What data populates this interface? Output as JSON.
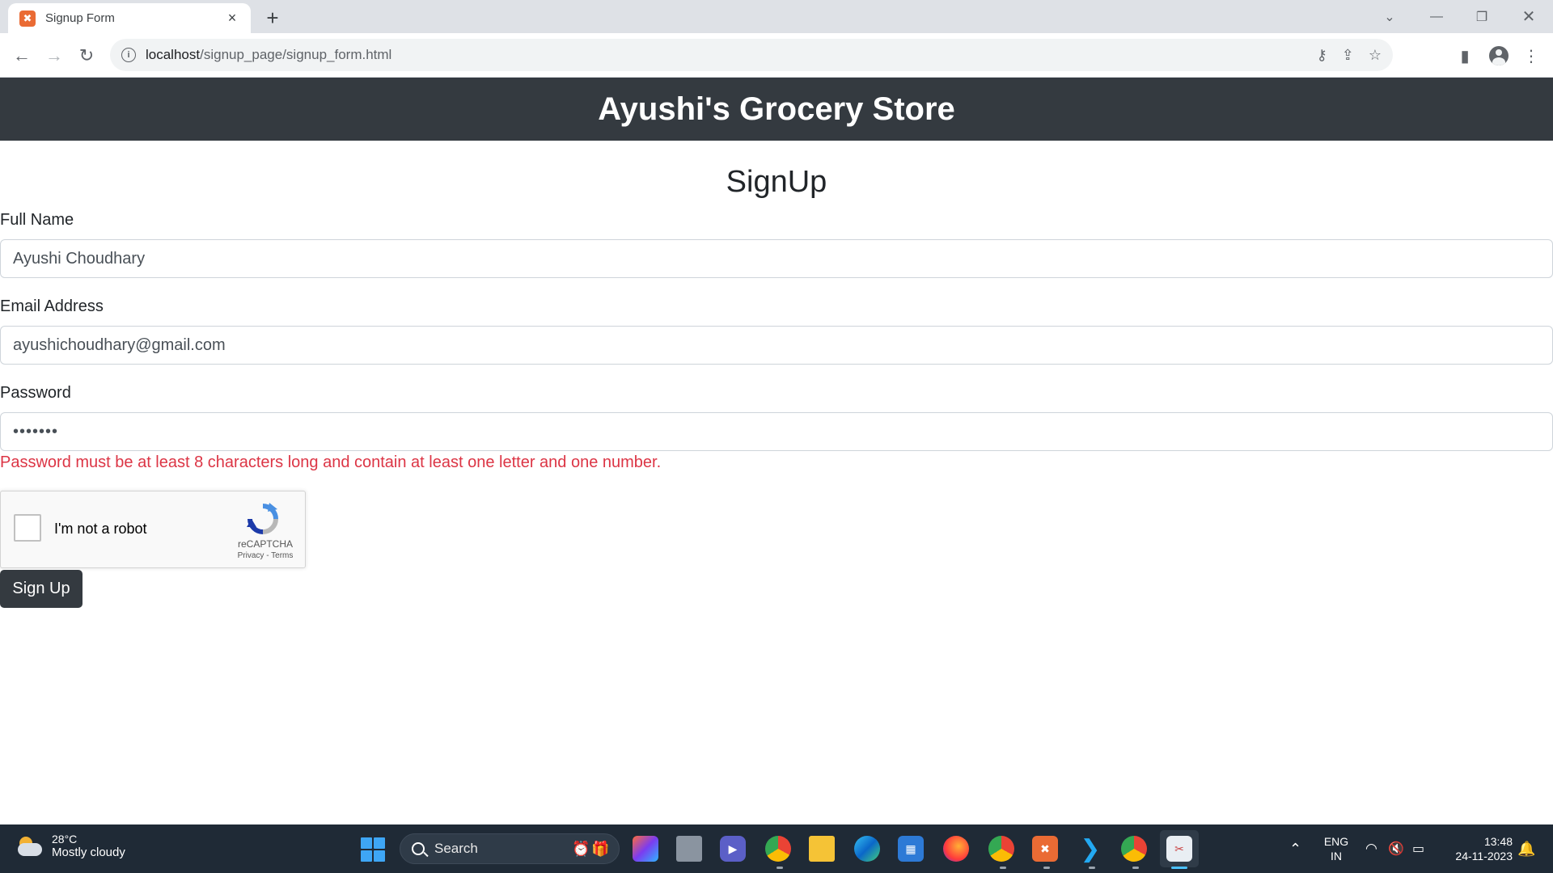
{
  "browser": {
    "tab_title": "Signup Form",
    "url_host": "localhost",
    "url_path": "/signup_page/signup_form.html",
    "favicon_letter": "✖"
  },
  "page": {
    "site_title": "Ayushi's Grocery Store",
    "form_title": "SignUp",
    "fields": {
      "full_name": {
        "label": "Full Name",
        "value": "Ayushi Choudhary"
      },
      "email": {
        "label": "Email Address",
        "value": "ayushichoudhary@gmail.com"
      },
      "password": {
        "label": "Password",
        "value": "•••••••"
      }
    },
    "password_error": "Password must be at least 8 characters long and contain at least one letter and one number.",
    "captcha": {
      "label": "I'm not a robot",
      "brand": "reCAPTCHA",
      "terms": "Privacy - Terms"
    },
    "submit_label": "Sign Up"
  },
  "taskbar": {
    "weather_temp": "28°C",
    "weather_desc": "Mostly cloudy",
    "search_label": "Search",
    "lang_line1": "ENG",
    "lang_line2": "IN",
    "time": "13:48",
    "date": "24-11-2023"
  },
  "colors": {
    "header_bg": "#343a40",
    "error": "#dc3545",
    "taskbar_bg": "#1f2a36"
  }
}
